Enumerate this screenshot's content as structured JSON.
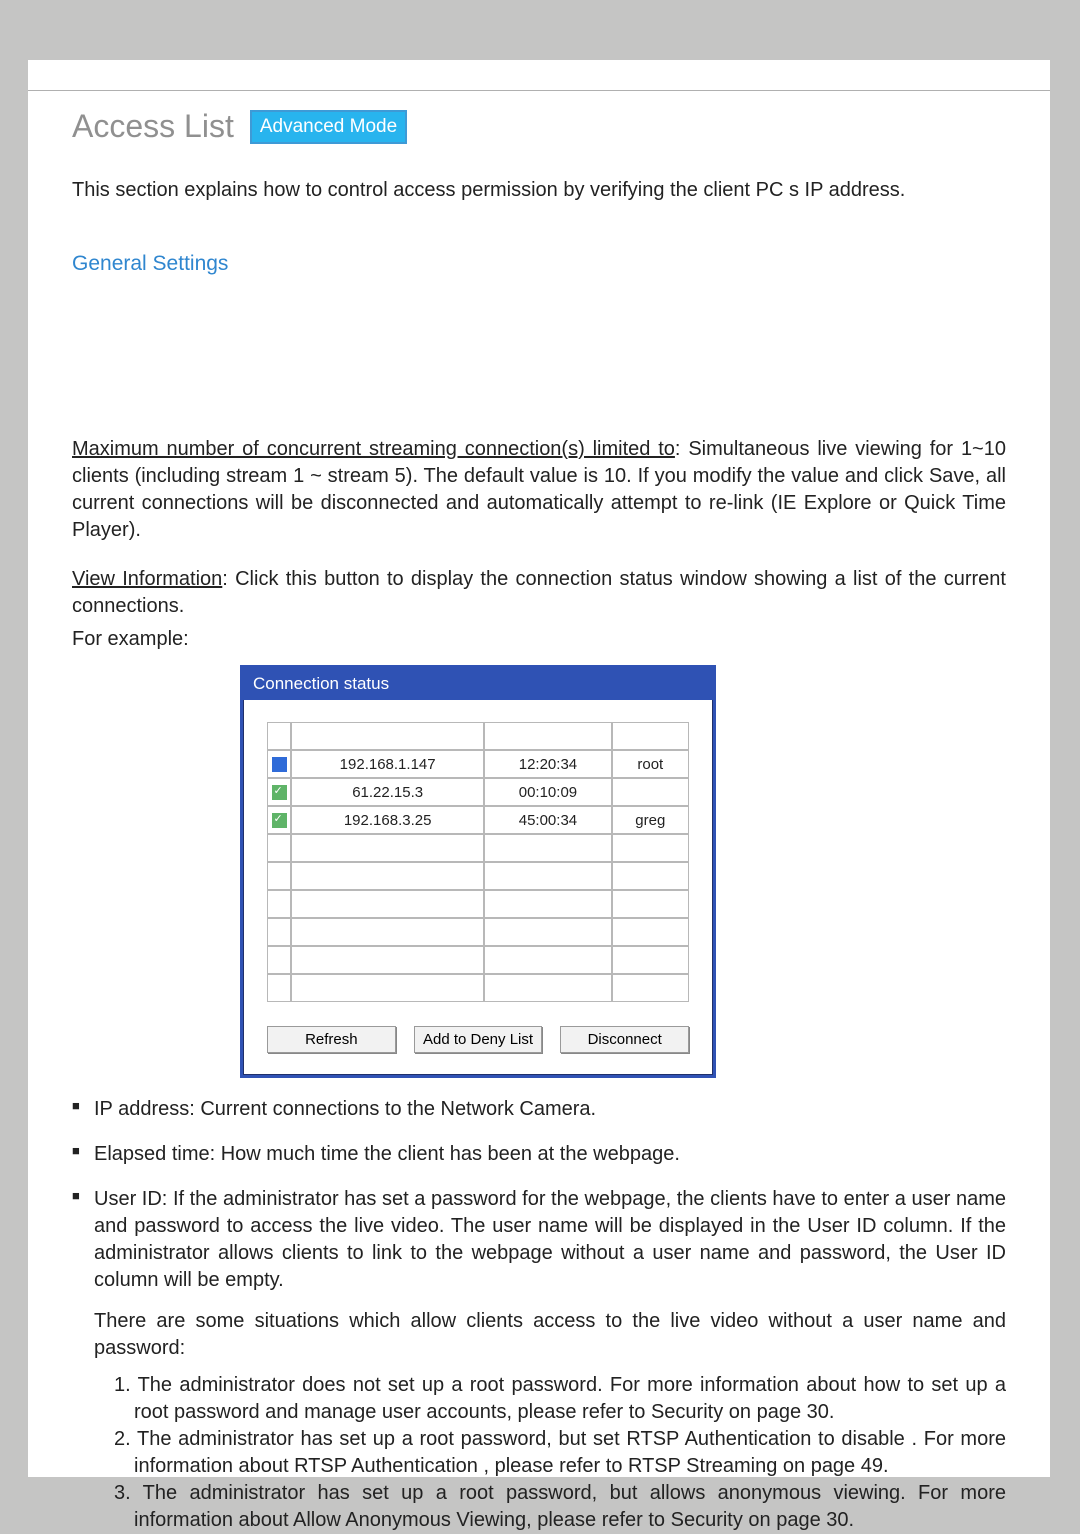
{
  "title": "Access List",
  "mode_badge": "Advanced Mode",
  "intro": "This section explains how to control access permission by verifying the client PC s IP address.",
  "general_settings_heading": "General Settings",
  "max_conn": {
    "label": "Maximum number of concurrent streaming connection(s) limited to",
    "text": ": Simultaneous live viewing for 1~10 clients (including stream 1 ~ stream 5). The default value is 10. If you modify the value and click Save, all current connections will be disconnected and automatically attempt to re-link (IE Explore or Quick Time Player)."
  },
  "view_info": {
    "label": "View Information",
    "text": ": Click this button to display the connection status window showing a list of the current connections."
  },
  "for_example": "For example:",
  "conn": {
    "title": "Connection status",
    "rows": [
      {
        "ip": "192.168.1.147",
        "time": "12:20:34",
        "user": "root"
      },
      {
        "ip": "61.22.15.3",
        "time": "00:10:09",
        "user": ""
      },
      {
        "ip": "192.168.3.25",
        "time": "45:00:34",
        "user": "greg"
      }
    ],
    "buttons": {
      "refresh": "Refresh",
      "add_deny": "Add to Deny List",
      "disconnect": "Disconnect"
    }
  },
  "bullets": [
    "IP address: Current connections to the Network Camera.",
    "Elapsed time: How much time the client has been at the webpage."
  ],
  "user_id_bullet": {
    "main": "User ID: If the administrator has set a password for the webpage, the clients have to enter a user name and password to access the live video. The user name will be displayed in the User ID column. If  the administrator allows clients to link to the webpage without a user name and password, the User ID column will be empty.",
    "sub1": "There are some situations which allow clients access to the live video without a user name and password:",
    "items": [
      "1. The administrator does not set up a root password. For more information about how to set up a root password and manage user accounts, please refer to Security on page 30.",
      "2. The administrator has set up a root password, but set RTSP Authentication to  disable . For more information about RTSP Authentication   , please refer to RTSP Streaming on page 49.",
      "3. The administrator has set up a root password, but allows anonymous viewing. For more information about Allow Anonymous Viewing,     please refer to Security on page 30."
    ]
  }
}
